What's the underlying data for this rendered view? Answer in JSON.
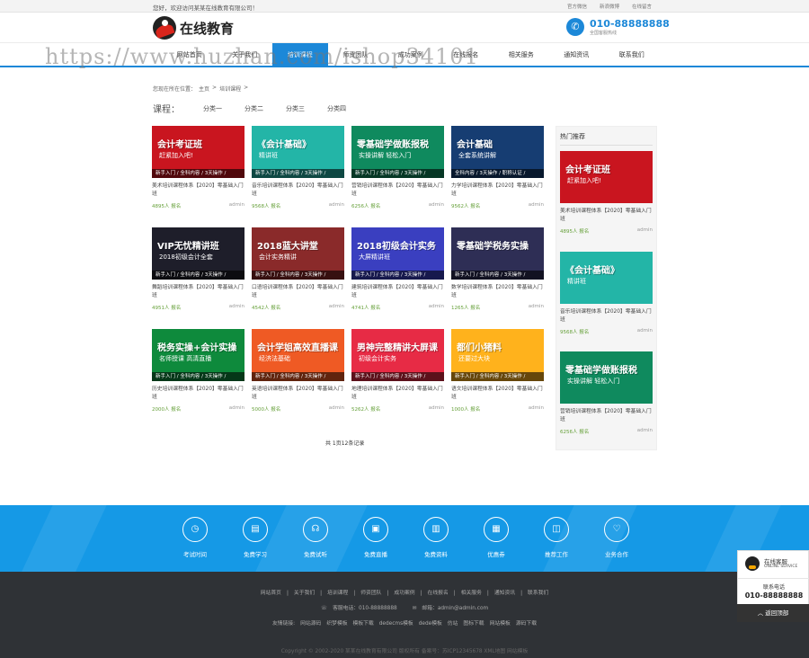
{
  "topbar": {
    "welcome": "您好，欢迎访问某某在线教育有限公司！",
    "links": [
      "官方微信",
      "新浪微博",
      "在线留言"
    ]
  },
  "header": {
    "logo_text": "在线教育",
    "phone": "010-88888888",
    "phone_sub": "全国客服热线"
  },
  "nav": {
    "items": [
      "网站首页",
      "关于我们",
      "培训课程",
      "师资团队",
      "成功案例",
      "在线报名",
      "相关服务",
      "通知资讯",
      "联系我们"
    ],
    "active_index": 2
  },
  "watermark": "https://www.huzhan.com/ishop34101",
  "breadcrumb": [
    "您现在所在位置：",
    "主页",
    ">",
    "培训课程",
    ">"
  ],
  "categories": {
    "label": "课程：",
    "items": [
      "分类一",
      "分类二",
      "分类三",
      "分类四"
    ]
  },
  "colors": {
    "brand_blue": "#1c88d8",
    "footer_blue": "#1599e6",
    "footer_dark": "#2f3236",
    "views_green": "#66a03a"
  },
  "courses": [
    {
      "headline": "会计考证班",
      "sub": "赶紧加入吧!",
      "strip": "新手入门 / 全科内容 / 3天操作 /",
      "bg": "#c9151f",
      "title": "美术培训课程体系【2020】零基础入门班",
      "views": "4895人 报名",
      "author": "admin"
    },
    {
      "headline": "《会计基础》",
      "sub": "精讲班",
      "strip": "新手入门 / 全科内容 / 3天操作 /",
      "bg": "#23b5a7",
      "title": "音乐培训课程体系【2020】零基础入门班",
      "views": "9568人 报名",
      "author": "admin"
    },
    {
      "headline": "零基础学做账报税",
      "sub": "实操讲解 轻松入门",
      "strip": "新手入门 / 全科内容 / 3天操作 /",
      "bg": "#0f8a5e",
      "title": "营销培训课程体系【2020】零基础入门班",
      "views": "6256人 报名",
      "author": "admin"
    },
    {
      "headline": "会计基础",
      "sub": "全套系统讲解",
      "strip": "全科内容 / 3天操作 / 职称认证 /",
      "bg": "#163d72",
      "title": "力学培训课程体系【2020】零基础入门班",
      "views": "9562人 报名",
      "author": "admin"
    },
    {
      "headline": "VIP无忧精讲班",
      "sub": "2018初级会计全套",
      "strip": "新手入门 / 全科内容 / 3天操作 /",
      "bg": "#1e1e2a",
      "title": "舞蹈培训课程体系【2020】零基础入门班",
      "views": "4951人 报名",
      "author": "admin"
    },
    {
      "headline": "2018蓝大讲堂",
      "sub": "会计实务精讲",
      "strip": "新手入门 / 全科内容 / 3天操作 /",
      "bg": "#8a2a2a",
      "title": "口语培训课程体系【2020】零基础入门班",
      "views": "4542人 报名",
      "author": "admin"
    },
    {
      "headline": "2018初级会计实务",
      "sub": "大屏精讲班",
      "strip": "新手入门 / 全科内容 / 3天操作 /",
      "bg": "#3a3fc0",
      "title": "建筑培训课程体系【2020】零基础入门班",
      "views": "4741人 报名",
      "author": "admin"
    },
    {
      "headline": "零基础学税务实操",
      "sub": "",
      "strip": "新手入门 / 全科内容 / 3天操作 /",
      "bg": "#2e2e55",
      "title": "数学培训课程体系【2020】零基础入门班",
      "views": "1265人 报名",
      "author": "admin"
    },
    {
      "headline": "税务实操+会计实操",
      "sub": "名师授课 高清直播",
      "strip": "新手入门 / 全科内容 / 3天操作 /",
      "bg": "#0e8a3c",
      "title": "历史培训课程体系【2020】零基础入门班",
      "views": "2000人 报名",
      "author": "admin"
    },
    {
      "headline": "会计学姐高效直播课",
      "sub": "经济法基础",
      "strip": "新手入门 / 全科内容 / 3天操作 /",
      "bg": "#ef5a24",
      "title": "英语培训课程体系【2020】零基础入门班",
      "views": "5000人 报名",
      "author": "admin"
    },
    {
      "headline": "男神完整精讲大屏课",
      "sub": "初级会计实务",
      "strip": "新手入门 / 全科内容 / 3天操作 /",
      "bg": "#e72b45",
      "title": "地理培训课程体系【2020】零基础入门班",
      "views": "5262人 报名",
      "author": "admin"
    },
    {
      "headline": "都们小猪料",
      "sub": "还要过大块",
      "strip": "新手入门 / 全科内容 / 3天操作 /",
      "bg": "#ffb21c",
      "title": "语文培训课程体系【2020】零基础入门班",
      "views": "1000人 报名",
      "author": "admin"
    }
  ],
  "pager": "共 1页12条记录",
  "sidebar": {
    "heading": "热门推荐",
    "items": [
      {
        "headline": "会计考证班",
        "sub": "赶紧加入吧!",
        "bg": "#c9151f",
        "title": "美术培训课程体系【2020】零基础入门班",
        "views": "4895人 报名",
        "author": "admin"
      },
      {
        "headline": "《会计基础》",
        "sub": "精讲班",
        "bg": "#23b5a7",
        "title": "音乐培训课程体系【2020】零基础入门班",
        "views": "9568人 报名",
        "author": "admin"
      },
      {
        "headline": "零基础学做账报税",
        "sub": "实操讲解 轻松入门",
        "bg": "#0f8a5e",
        "title": "营销培训课程体系【2020】零基础入门班",
        "views": "6256人 报名",
        "author": "admin"
      }
    ]
  },
  "footer_features": [
    {
      "label": "考试时间",
      "icon": "clock-icon",
      "glyph": "◷"
    },
    {
      "label": "免费学习",
      "icon": "book-icon",
      "glyph": "▤"
    },
    {
      "label": "免费试听",
      "icon": "headset-icon",
      "glyph": "☊"
    },
    {
      "label": "免费直播",
      "icon": "live-icon",
      "glyph": "▣"
    },
    {
      "label": "免费资料",
      "icon": "document-icon",
      "glyph": "▥"
    },
    {
      "label": "优惠券",
      "icon": "coupon-icon",
      "glyph": "▦"
    },
    {
      "label": "推荐工作",
      "icon": "briefcase-icon",
      "glyph": "◫"
    },
    {
      "label": "业务合作",
      "icon": "handshake-icon",
      "glyph": "♡"
    }
  ],
  "footer": {
    "links": [
      "网站首页",
      "关于我们",
      "培训课程",
      "师资团队",
      "成功案例",
      "在线报名",
      "相关服务",
      "通知资讯",
      "联系我们"
    ],
    "contact_phone": "客服电话：010-88888888",
    "contact_email": "邮箱：admin@admin.com",
    "friend_label": "友情链接:",
    "friend_links": [
      "网站源码",
      "织梦模板",
      "模板下载",
      "dedecms模板",
      "dede模板",
      "仿站",
      "图标下载",
      "网站模板",
      "源码下载"
    ],
    "copyright": "Copyright © 2002-2020 某某在线教育有限公司 版权所有  备案号：苏ICP12345678 XML地图 网站模板"
  },
  "service": {
    "title": "在线客服",
    "subtitle": "ONLINE SERVICE",
    "phone_label": "联系电话",
    "phone": "010-88888888",
    "back_top": "返回顶部"
  }
}
